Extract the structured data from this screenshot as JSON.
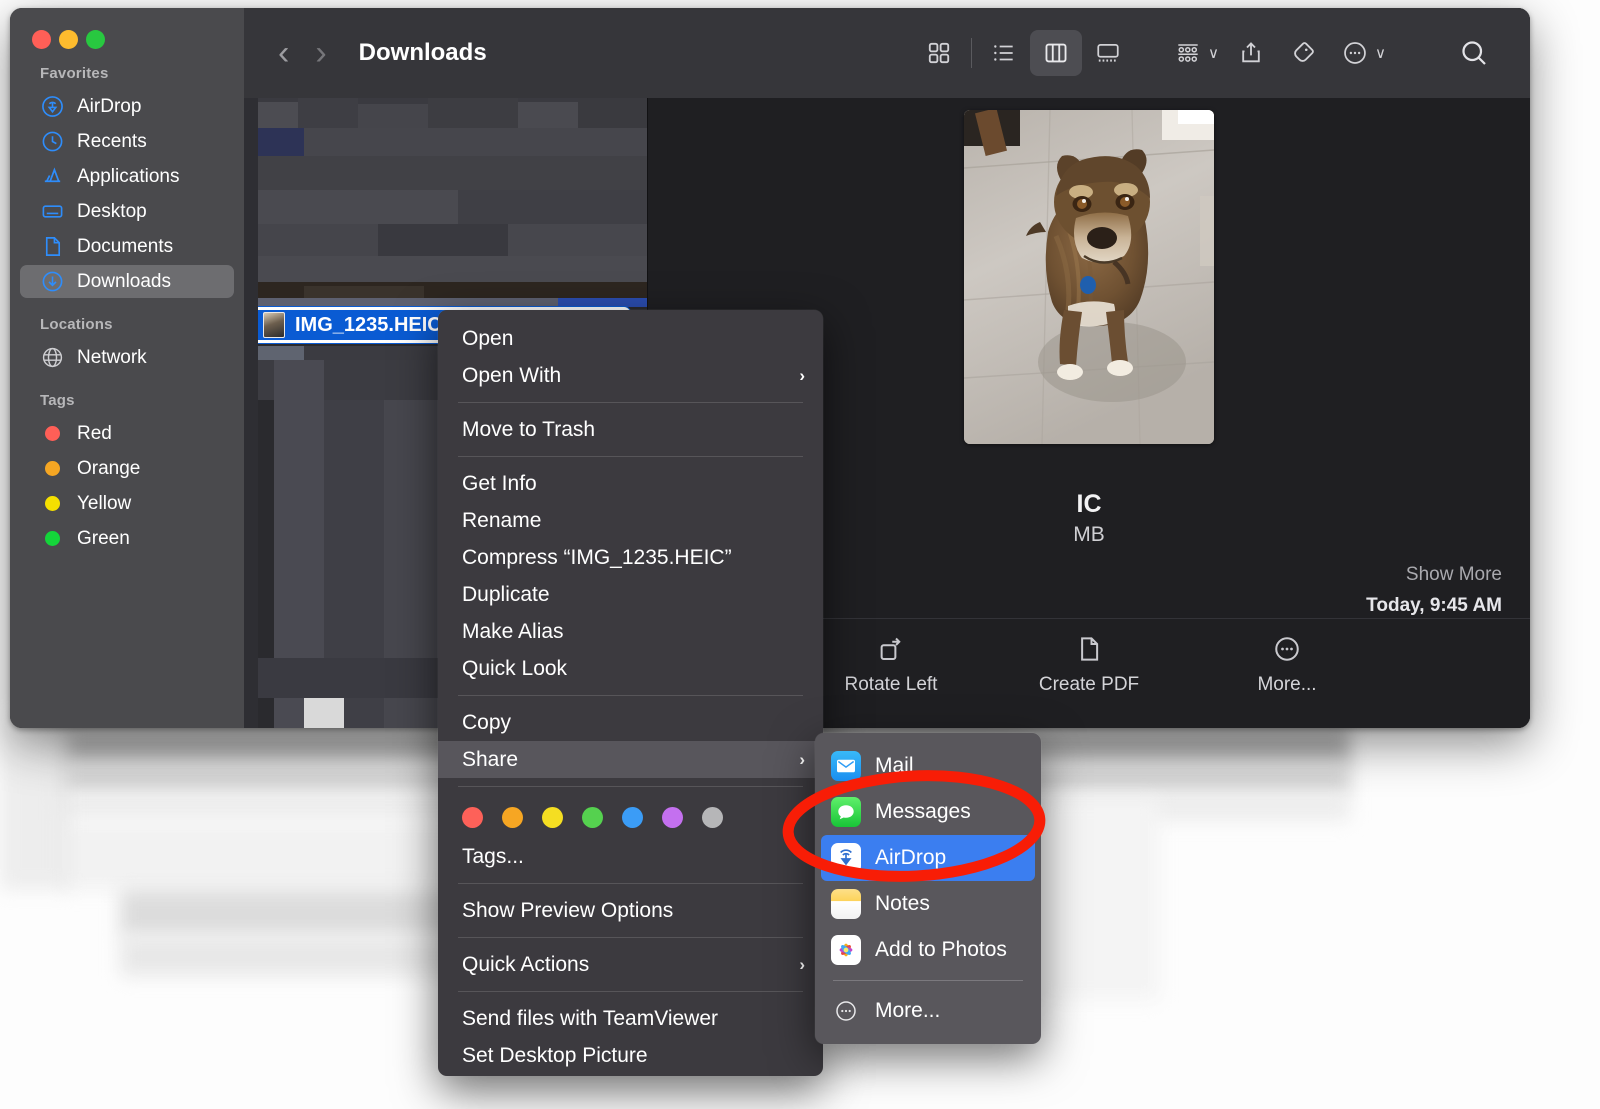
{
  "window": {
    "title": "Downloads",
    "traffic_lights": [
      {
        "name": "close",
        "color": "#ff5f57"
      },
      {
        "name": "minimize",
        "color": "#febc2e"
      },
      {
        "name": "zoom",
        "color": "#28c840"
      }
    ]
  },
  "toolbar": {
    "back_glyph": "‹",
    "forward_glyph": "›",
    "title": "Downloads",
    "view_modes": [
      {
        "name": "icon-view",
        "label": "Icon View",
        "active": false
      },
      {
        "name": "list-view",
        "label": "List View",
        "active": false
      },
      {
        "name": "column-view",
        "label": "Column View",
        "active": true
      },
      {
        "name": "gallery-view",
        "label": "Gallery View",
        "active": false
      }
    ],
    "actions": [
      {
        "name": "group-by",
        "label": "Group Items"
      },
      {
        "name": "share",
        "label": "Share"
      },
      {
        "name": "tags",
        "label": "Edit Tags"
      },
      {
        "name": "more",
        "label": "More"
      },
      {
        "name": "search",
        "label": "Search"
      }
    ],
    "caret_glyph": "∨"
  },
  "sidebar": {
    "sections": [
      {
        "title": "Favorites",
        "items": [
          {
            "label": "AirDrop",
            "icon": "airdrop-icon",
            "active": false
          },
          {
            "label": "Recents",
            "icon": "clock-icon",
            "active": false
          },
          {
            "label": "Applications",
            "icon": "applications-icon",
            "active": false
          },
          {
            "label": "Desktop",
            "icon": "desktop-icon",
            "active": false
          },
          {
            "label": "Documents",
            "icon": "document-icon",
            "active": false
          },
          {
            "label": "Downloads",
            "icon": "download-icon",
            "active": true
          }
        ]
      },
      {
        "title": "Locations",
        "items": [
          {
            "label": "Network",
            "icon": "globe-icon",
            "active": false
          }
        ]
      },
      {
        "title": "Tags",
        "items": [
          {
            "label": "Red",
            "icon": "tag-dot",
            "color": "#ff5f57",
            "active": false
          },
          {
            "label": "Orange",
            "icon": "tag-dot",
            "color": "#f5a623",
            "active": false
          },
          {
            "label": "Yellow",
            "icon": "tag-dot",
            "color": "#f5e000",
            "active": false
          },
          {
            "label": "Green",
            "icon": "tag-dot",
            "color": "#14d43a",
            "active": false
          }
        ]
      }
    ]
  },
  "file_list": {
    "selected_file": "IMG_1235.HEIC"
  },
  "preview": {
    "filename_visible": "IC",
    "filesize_visible": "MB",
    "show_more": "Show More",
    "date": "Today, 9:45 AM",
    "quick_actions": [
      {
        "label": "Rotate Left",
        "icon": "rotate-left-icon"
      },
      {
        "label": "Create PDF",
        "icon": "document-icon"
      },
      {
        "label": "More...",
        "icon": "ellipsis-circle-icon"
      }
    ],
    "image_alt": "Brown and tan dog sitting on light tile floor"
  },
  "context_menu": {
    "items": [
      {
        "label": "Open",
        "submenu": false
      },
      {
        "label": "Open With",
        "submenu": true
      },
      {
        "separator_after": true
      },
      {
        "label": "Move to Trash",
        "submenu": false
      },
      {
        "separator_after": true
      },
      {
        "label": "Get Info",
        "submenu": false
      },
      {
        "label": "Rename",
        "submenu": false
      },
      {
        "label": "Compress “IMG_1235.HEIC”",
        "submenu": false
      },
      {
        "label": "Duplicate",
        "submenu": false
      },
      {
        "label": "Make Alias",
        "submenu": false
      },
      {
        "label": "Quick Look",
        "submenu": false
      },
      {
        "separator_after": true
      },
      {
        "label": "Copy",
        "submenu": false
      },
      {
        "label": "Share",
        "submenu": true,
        "selected": true
      },
      {
        "separator_after": true
      },
      {
        "label": "Tags...",
        "submenu": false
      },
      {
        "separator_after": true
      },
      {
        "label": "Show Preview Options",
        "submenu": false
      },
      {
        "separator_after": true
      },
      {
        "label": "Quick Actions",
        "submenu": true
      },
      {
        "separator_after": true
      },
      {
        "label": "Send files with TeamViewer",
        "submenu": false
      },
      {
        "label": "Set Desktop Picture",
        "submenu": false
      }
    ],
    "tag_colors": [
      {
        "name": "red",
        "color": "#fd6159"
      },
      {
        "name": "orange",
        "color": "#f6a623"
      },
      {
        "name": "yellow",
        "color": "#f5de22"
      },
      {
        "name": "green",
        "color": "#55d14f"
      },
      {
        "name": "blue",
        "color": "#3b9cf6"
      },
      {
        "name": "purple",
        "color": "#c470ef"
      },
      {
        "name": "gray",
        "color": "#b6b6b8"
      }
    ],
    "arrow_glyph": "›"
  },
  "share_submenu": {
    "items": [
      {
        "label": "Mail",
        "icon": "mail-icon",
        "selected": false
      },
      {
        "label": "Messages",
        "icon": "messages-icon",
        "selected": false
      },
      {
        "label": "AirDrop",
        "icon": "airdrop-icon",
        "selected": true
      },
      {
        "label": "Notes",
        "icon": "notes-icon",
        "selected": false
      },
      {
        "label": "Add to Photos",
        "icon": "photos-icon",
        "selected": false
      },
      {
        "label": "More...",
        "icon": "ellipsis-circle-icon",
        "selected": false
      }
    ]
  },
  "annotation": {
    "shape": "ellipse",
    "color": "#f81d06",
    "target": "AirDrop"
  }
}
